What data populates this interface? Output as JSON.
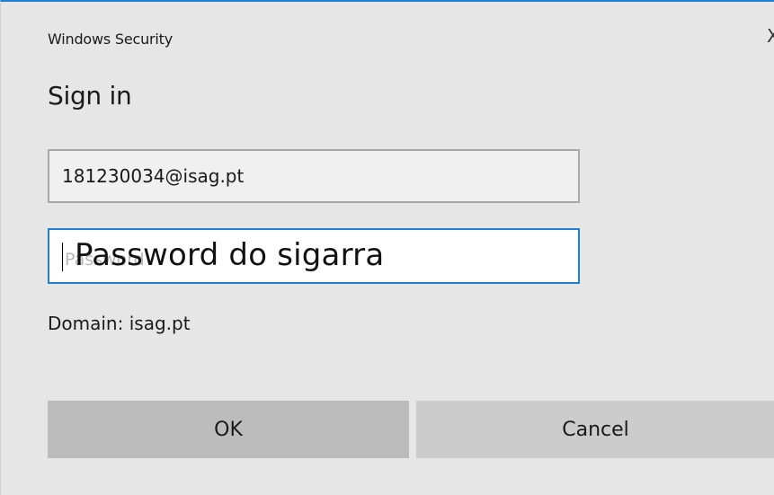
{
  "window": {
    "title": "Windows Security",
    "close_glyph": "X"
  },
  "dialog": {
    "heading": "Sign in"
  },
  "username": {
    "value": "181230034@isag.pt"
  },
  "password": {
    "placeholder": "Password",
    "overlay_text": "Password do sigarra"
  },
  "domain": {
    "label": "Domain:",
    "value": "isag.pt"
  },
  "buttons": {
    "ok_label": "OK",
    "cancel_label": "Cancel"
  },
  "colors": {
    "accent": "#1f7fd4",
    "dialog_background": "#e6e6e6",
    "ok_button": "#bcbcbc",
    "cancel_button": "#cccccc"
  },
  "icons": {
    "close": "close-icon"
  }
}
